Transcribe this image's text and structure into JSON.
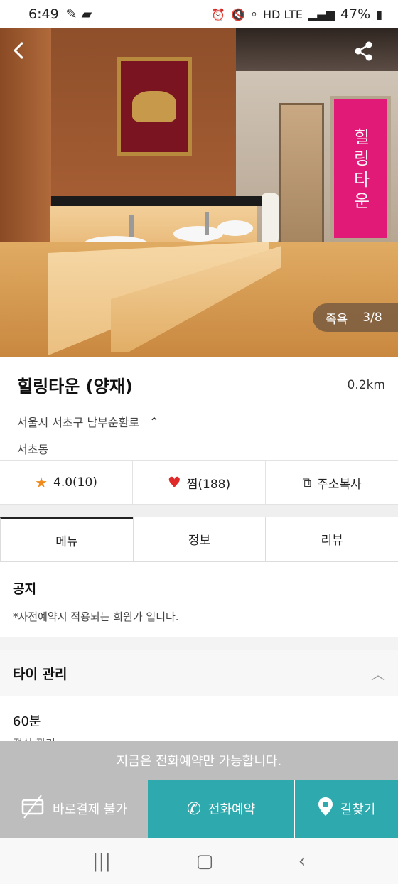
{
  "status_bar": {
    "time": "6:49",
    "network": "HD LTE",
    "battery": "47%"
  },
  "hero": {
    "banner_text": "힐링타운",
    "category": "족욕",
    "counter": "3/8"
  },
  "shop": {
    "name": "힐링타운 (양재)",
    "distance": "0.2km",
    "address_line1": "서울시 서초구 남부순환로",
    "address_line2": "서초동"
  },
  "actions": {
    "rating": "4.0(10)",
    "favorite": "찜(188)",
    "copy_address": "주소복사"
  },
  "tabs": [
    "메뉴",
    "정보",
    "리뷰"
  ],
  "notice": {
    "heading": "공지",
    "text": "*사전예약시 적용되는 회원가 입니다."
  },
  "section": {
    "title": "타이 관리"
  },
  "menu_item": {
    "duration": "60분",
    "description": "전신 관리"
  },
  "banner_msg": "지금은 전화예약만 가능합니다.",
  "bottom_bar": {
    "pay": "바로결제 불가",
    "call": "전화예약",
    "route": "길찾기"
  },
  "colors": {
    "accent": "#2ea9ad",
    "disabled": "#bdbdbd",
    "star": "#f08a1c",
    "heart": "#e02a2a"
  }
}
